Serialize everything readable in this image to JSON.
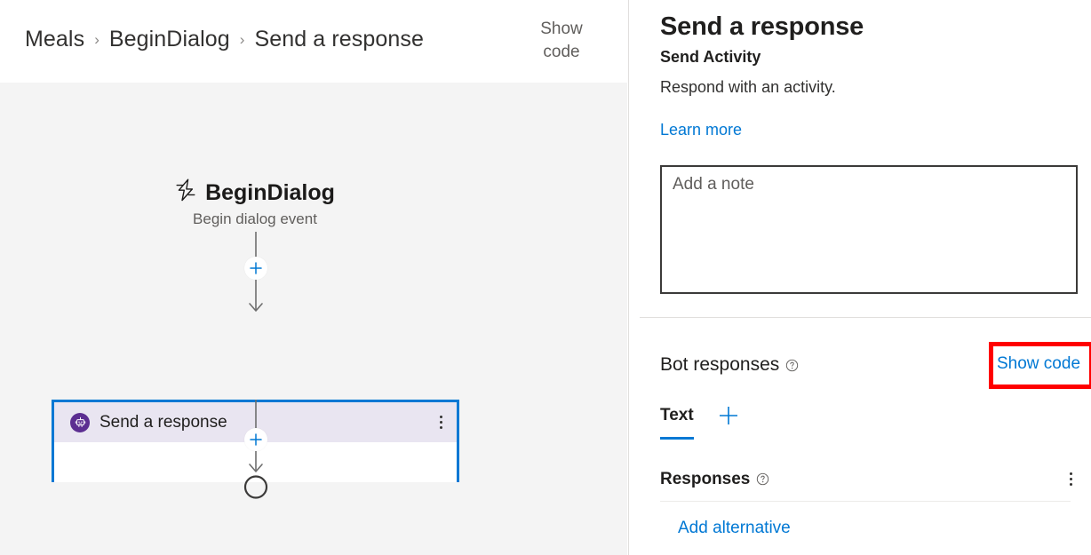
{
  "colors": {
    "accent": "#0078d4",
    "highlight": "#ff0000",
    "bot_icon_bg": "#5c2e91",
    "node_header_bg": "#e9e5f1",
    "canvas_bg": "#f4f4f4"
  },
  "header": {
    "breadcrumb": [
      {
        "label": "Meals"
      },
      {
        "label": "BeginDialog"
      },
      {
        "label": "Send a response"
      }
    ],
    "separator": "›",
    "show_code_label": "Show\ncode",
    "show_code_line1": "Show",
    "show_code_line2": "code"
  },
  "canvas": {
    "trigger": {
      "icon": "lightning-bolt-icon",
      "title": "BeginDialog",
      "subtitle": "Begin dialog event"
    },
    "add_node_label": "+",
    "action_node": {
      "icon": "bot-icon",
      "title": "Send a response",
      "menu_label": "More options",
      "selected": true
    },
    "end_node_label": "End of dialog"
  },
  "panel": {
    "title": "Send a response",
    "subtitle": "Send Activity",
    "description": "Respond with an activity.",
    "learn_more_label": "Learn more",
    "note": {
      "placeholder": "Add a note",
      "value": ""
    },
    "bot_responses": {
      "label": "Bot responses",
      "help_icon": "question-circle-icon",
      "show_code_label": "Show code"
    },
    "tabs": [
      {
        "label": "Text",
        "active": true
      }
    ],
    "add_tab_label": "+",
    "responses": {
      "label": "Responses",
      "help_icon": "question-circle-icon",
      "menu_label": "More options",
      "add_alternative_label": "Add alternative"
    }
  }
}
